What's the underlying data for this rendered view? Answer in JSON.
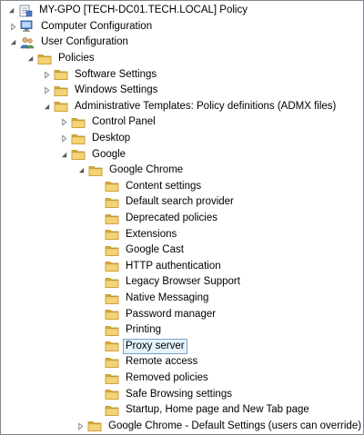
{
  "tree": {
    "root": {
      "label": "MY-GPO [TECH-DC01.TECH.LOCAL] Policy"
    },
    "computer_configuration": {
      "label": "Computer Configuration"
    },
    "user_configuration": {
      "label": "User Configuration"
    },
    "policies": {
      "label": "Policies"
    },
    "software_settings": {
      "label": "Software Settings"
    },
    "windows_settings": {
      "label": "Windows Settings"
    },
    "administrative_templates": {
      "label": "Administrative Templates: Policy definitions (ADMX files)"
    },
    "control_panel": {
      "label": "Control Panel"
    },
    "desktop": {
      "label": "Desktop"
    },
    "google": {
      "label": "Google"
    },
    "google_chrome": {
      "label": "Google Chrome"
    },
    "chrome_items": [
      {
        "label": "Content settings"
      },
      {
        "label": "Default search provider"
      },
      {
        "label": "Deprecated policies"
      },
      {
        "label": "Extensions"
      },
      {
        "label": "Google Cast"
      },
      {
        "label": "HTTP authentication"
      },
      {
        "label": "Legacy Browser Support"
      },
      {
        "label": "Native Messaging"
      },
      {
        "label": "Password manager"
      },
      {
        "label": "Printing"
      },
      {
        "label": "Proxy server",
        "selected": true
      },
      {
        "label": "Remote access"
      },
      {
        "label": "Removed policies"
      },
      {
        "label": "Safe Browsing settings"
      },
      {
        "label": "Startup, Home page and New Tab page"
      }
    ],
    "google_chrome_default": {
      "label": "Google Chrome - Default Settings (users can override)"
    }
  },
  "colors": {
    "folder": "#e8c05a",
    "folder_dark": "#c9a23d",
    "selection_bg": "#e5f3fb",
    "selection_border": "#7da2ce"
  }
}
